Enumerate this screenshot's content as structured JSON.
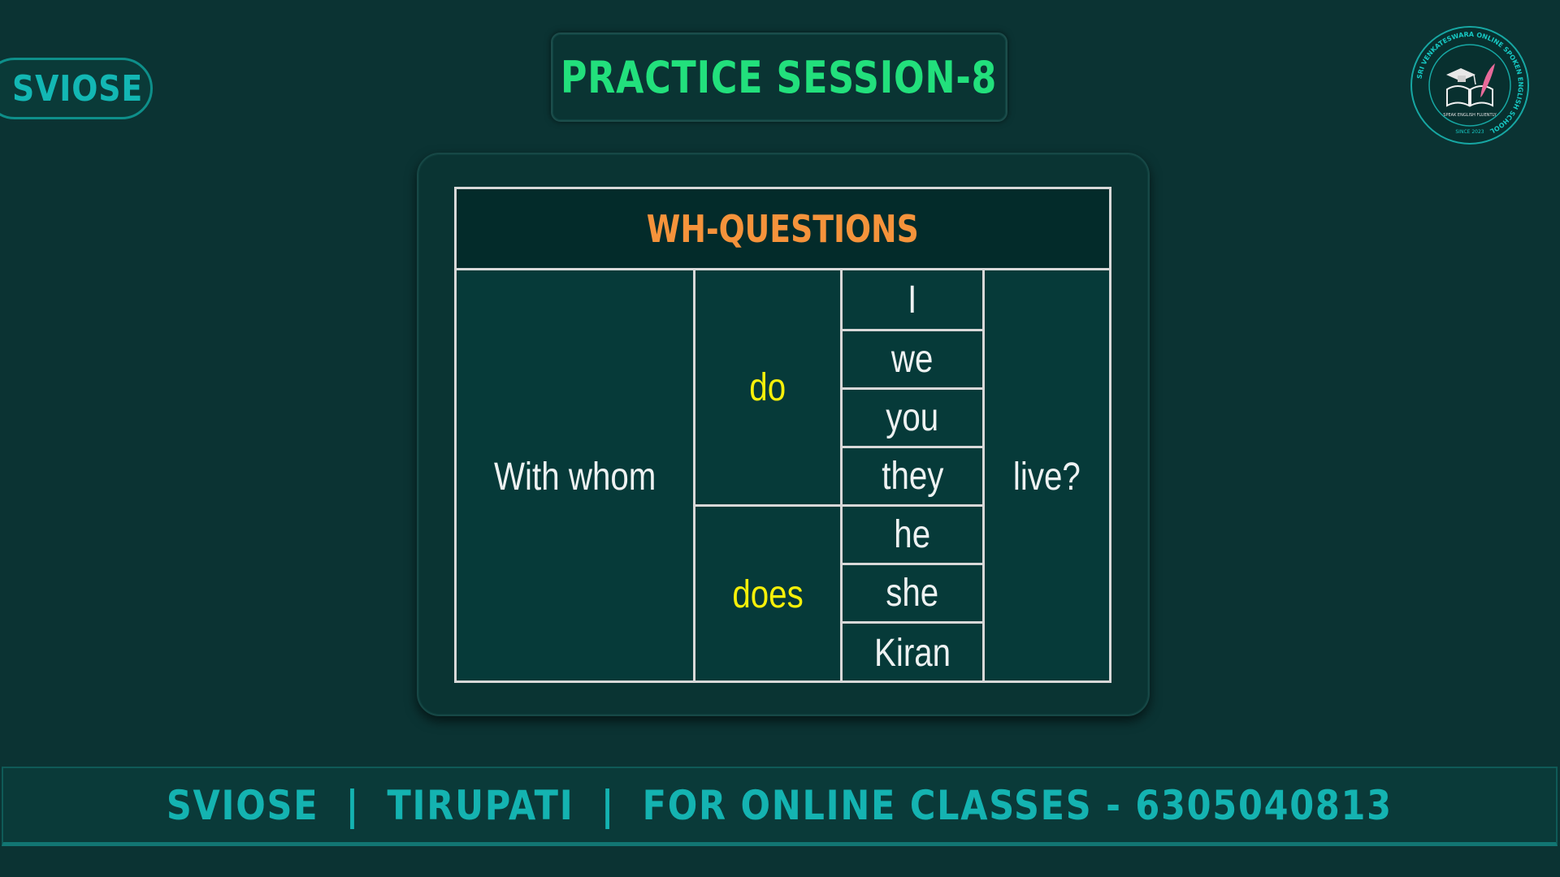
{
  "brand_tag": "SVIOSE",
  "title": "PRACTICE SESSION-8",
  "logo": {
    "ring_text": "SRI VENKATESWARA ONLINE SPOKEN ENGLISH SCHOOL",
    "tagline": "SPEAK ENGLISH FLUENTLY",
    "since": "SINCE 2023",
    "icon": "book-graduation-cap-quill-icon"
  },
  "table": {
    "heading": "WH-QUESTIONS",
    "question_word": "With whom",
    "aux_do": "do",
    "aux_does": "does",
    "subjects_do": [
      "I",
      "we",
      "you",
      "they"
    ],
    "subjects_does": [
      "he",
      "she",
      "Kiran"
    ],
    "verb": "live?"
  },
  "footer": "SVIOSE  |  TIRUPATI  |  FOR ONLINE CLASSES - 6305040813",
  "colors": {
    "background": "#0b3333",
    "title_green": "#22e07c",
    "heading_orange": "#f5933b",
    "aux_yellow": "#f7f009",
    "teal_accent": "#14b3b1"
  }
}
